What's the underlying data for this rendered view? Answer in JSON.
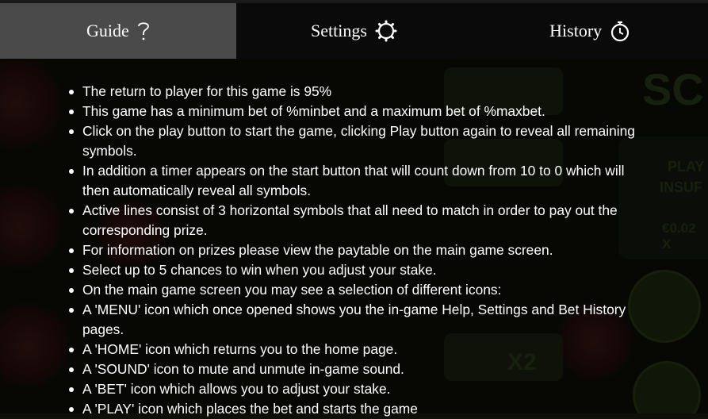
{
  "tabs": [
    {
      "label": "Guide",
      "icon": "question-mark-icon",
      "active": true
    },
    {
      "label": "Settings",
      "icon": "gear-icon",
      "active": false
    },
    {
      "label": "History",
      "icon": "stopwatch-icon",
      "active": false
    }
  ],
  "rules": [
    "The return to player for this game is 95%",
    "This game has a minimum bet of %minbet and a maximum bet of %maxbet.",
    "Click on the play button to start the game, clicking Play button again to reveal all remaining symbols.",
    "In addition a timer appears on the start button that will count down from 10 to 0 which will then automatically reveal all symbols.",
    "Active lines consist of 3 horizontal symbols that all need to match in order to pay out the corresponding prize.",
    "For information on prizes please view the paytable on the main game screen.",
    "Select up to 5 chances to win when you adjust your stake.",
    "On the main game screen you may see a selection of different icons:",
    "A 'MENU' icon which once opened shows you the in-game Help, Settings and Bet History pages.",
    "A 'HOME' icon which returns you to the home page.",
    "A 'SOUND' icon to mute and unmute in-game sound.",
    "A 'BET' icon which allows you to adjust your stake.",
    "A 'PLAY' icon which places the bet and starts the game"
  ],
  "background": {
    "ghost_texts": [
      "SC",
      "PLAY",
      "INSUF",
      "€0.02 X",
      "X2"
    ]
  },
  "colors": {
    "active_tab": "#4a4a4a",
    "tab_bg": "#0a0a0a",
    "text": "#ffffff"
  }
}
